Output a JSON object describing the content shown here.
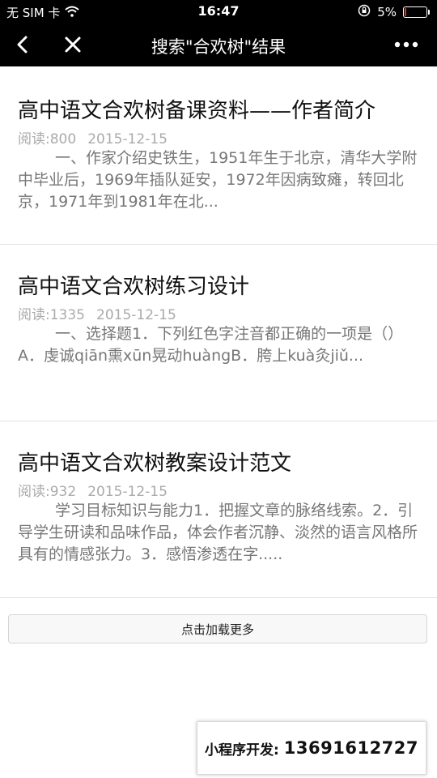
{
  "status_bar": {
    "carrier": "无 SIM 卡",
    "time": "16:47",
    "battery_percent_label": "5%",
    "battery_level": 0.05,
    "battery_color": "#e33333"
  },
  "navbar": {
    "title": "搜索\"合欢树\"结果",
    "back_icon": "chevron-left-icon",
    "close_icon": "close-icon",
    "more_icon": "more-dots-icon"
  },
  "articles": [
    {
      "title": "高中语文合欢树备课资料——作者简介",
      "read_label": "阅读:800",
      "date": "2015-12-15",
      "summary": "一、作家介绍史铁生，1951年生于北京，清华大学附中毕业后，1969年插队延安，1972年因病致瘫，转回北京，1971年到1981年在北..."
    },
    {
      "title": "高中语文合欢树练习设计",
      "read_label": "阅读:1335",
      "date": "2015-12-15",
      "summary": "一、选择题1．下列红色字注音都正确的一项是（）A．虔诚qiān熏xūn晃动huàngB．胯上kuà灸jiǔ..."
    },
    {
      "title": "高中语文合欢树教案设计范文",
      "read_label": "阅读:932",
      "date": "2015-12-15",
      "summary": "学习目标知识与能力1．把握文章的脉络线索。2．引导学生研读和品味作品，体会作者沉静、淡然的语言风格所具有的情感张力。3．感悟渗透在字....."
    }
  ],
  "load_more": {
    "label": "点击加载更多"
  },
  "ad": {
    "label": "小程序开发:",
    "phone": "13691612727"
  }
}
